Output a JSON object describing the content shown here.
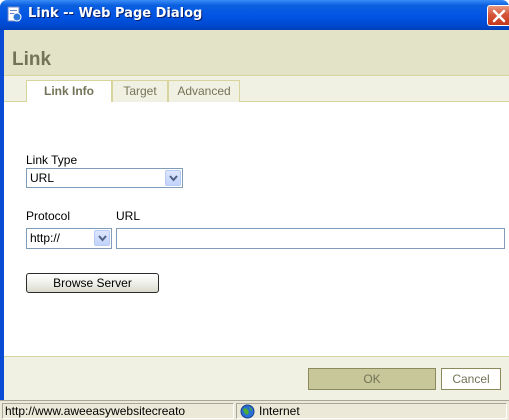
{
  "window": {
    "title": "Link -- Web Page Dialog",
    "title_icon": "ie-page-icon",
    "close_icon": "close-icon",
    "accent_color": "#0054e3"
  },
  "dialog": {
    "heading": "Link",
    "tabs": [
      {
        "label": "Link Info",
        "active": true
      },
      {
        "label": "Target",
        "active": false
      },
      {
        "label": "Advanced",
        "active": false
      }
    ]
  },
  "form": {
    "link_type_label": "Link Type",
    "link_type_value": "URL",
    "protocol_label": "Protocol",
    "protocol_value": "http://",
    "url_label": "URL",
    "url_value": "",
    "browse_button": "Browse Server"
  },
  "footer": {
    "ok_label": "OK",
    "cancel_label": "Cancel"
  },
  "statusbar": {
    "url_text": "http://www.aweeasywebsitecreato",
    "zone_text": "Internet",
    "zone_icon": "globe-icon"
  }
}
